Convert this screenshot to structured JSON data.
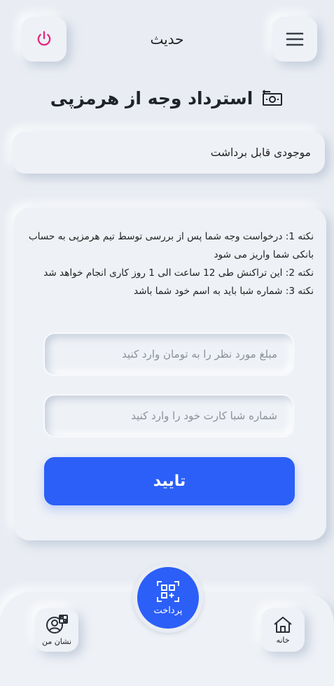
{
  "header": {
    "title": "حدیث",
    "power_icon": "power-icon",
    "menu_icon": "hamburger-menu-icon",
    "power_color": "#e6287f"
  },
  "page": {
    "heading": "استرداد وجه از هرمزپی",
    "heading_icon": "money-refund-icon"
  },
  "balance": {
    "label": "موجودی قابل برداشت"
  },
  "notes": [
    "نکته 1: درخواست وجه شما پس از بررسی توسط تیم هرمزپی به حساب بانکی شما واریز می شود",
    "نکته 2: این تراکنش طی 12 ساعت الی 1 روز کاری انجام خواهد شد",
    "نکته 3: شماره شبا باید به اسم خود شما باشد"
  ],
  "form": {
    "amount_placeholder": "مبلغ مورد نظر را به تومان وارد کنید",
    "sheba_placeholder": "شماره شبا کارت خود را وارد کنید",
    "submit_label": "تایید"
  },
  "bottom_nav": {
    "home_label": "خانه",
    "pay_label": "پرداخت",
    "mysign_label": "نشان من"
  },
  "colors": {
    "accent": "#2b5ff8",
    "background": "#e9edf3"
  }
}
